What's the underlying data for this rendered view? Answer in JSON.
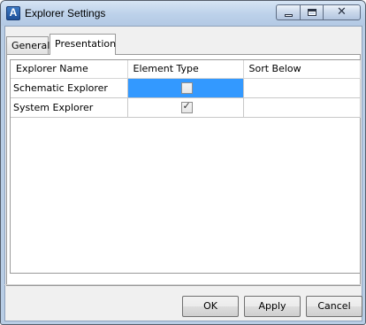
{
  "window": {
    "title": "Explorer Settings",
    "app_icon": "A"
  },
  "tabs": [
    {
      "label": "General",
      "active": false
    },
    {
      "label": "Presentation",
      "active": true
    }
  ],
  "grid": {
    "columns": [
      "Explorer Name",
      "Element Type",
      "Sort Below"
    ],
    "rows": [
      {
        "name": "Schematic Explorer",
        "element_type_checked": false,
        "element_type_mark": "",
        "sort_below": ""
      },
      {
        "name": "System Explorer",
        "element_type_checked": true,
        "element_type_mark": "✓",
        "sort_below": ""
      }
    ]
  },
  "buttons": {
    "ok": "OK",
    "apply": "Apply",
    "cancel": "Cancel"
  },
  "colors": {
    "selection": "#3399ff"
  }
}
